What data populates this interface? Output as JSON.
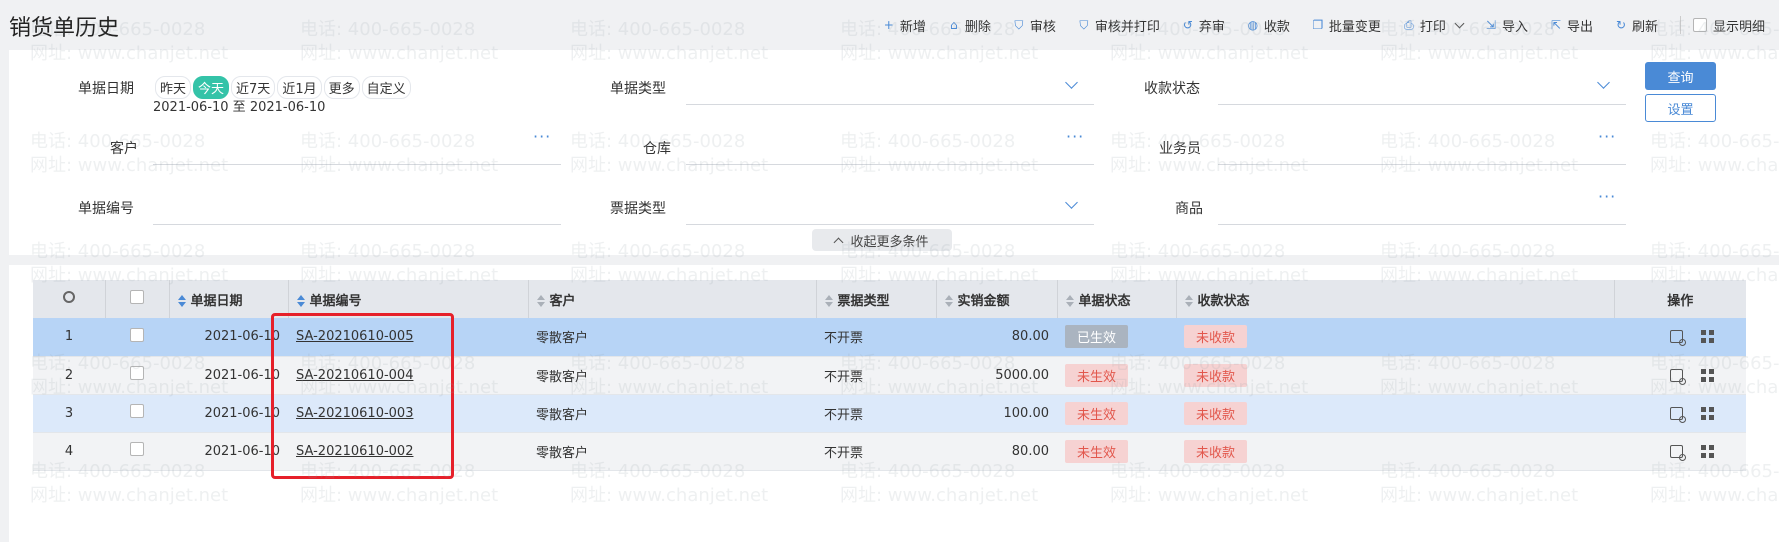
{
  "header": {
    "title": "销货单历史",
    "toolbar": [
      {
        "label": "新增",
        "icon": "plus-icon"
      },
      {
        "label": "删除",
        "icon": "trash-icon"
      },
      {
        "label": "审核",
        "icon": "shield-check-icon"
      },
      {
        "label": "审核并打印",
        "icon": "shield-print-icon"
      },
      {
        "label": "弃审",
        "icon": "undo-icon"
      },
      {
        "label": "收款",
        "icon": "wallet-icon"
      },
      {
        "label": "批量变更",
        "icon": "copy-icon"
      },
      {
        "label": "打印",
        "icon": "printer-icon"
      },
      {
        "label": "导入",
        "icon": "import-icon"
      },
      {
        "label": "导出",
        "icon": "export-icon"
      },
      {
        "label": "刷新",
        "icon": "refresh-icon"
      }
    ],
    "show_detail_label": "显示明细"
  },
  "filters": {
    "date_label": "单据日期",
    "date_options": [
      "昨天",
      "今天",
      "近7天",
      "近1月",
      "更多",
      "自定义"
    ],
    "date_active": "今天",
    "date_range": "2021-06-10 至 2021-06-10",
    "bill_type_label": "单据类型",
    "payment_status_label": "收款状态",
    "customer_label": "客户",
    "warehouse_label": "仓库",
    "salesperson_label": "业务员",
    "bill_no_label": "单据编号",
    "invoice_type_label": "票据类型",
    "product_label": "商品",
    "query_label": "查询",
    "settings_label": "设置",
    "collapse_label": "收起更多条件"
  },
  "table": {
    "columns": {
      "date": "单据日期",
      "bill_no": "单据编号",
      "customer": "客户",
      "invoice_type": "票据类型",
      "amount": "实销金额",
      "bill_status": "单据状态",
      "payment_status": "收款状态",
      "ops": "操作"
    },
    "rows": [
      {
        "idx": "1",
        "date": "2021-06-10",
        "bill_no": "SA-20210610-005",
        "customer": "零散客户",
        "invoice_type": "不开票",
        "amount": "80.00",
        "bill_status": "已生效",
        "payment_status": "未收款"
      },
      {
        "idx": "2",
        "date": "2021-06-10",
        "bill_no": "SA-20210610-004",
        "customer": "零散客户",
        "invoice_type": "不开票",
        "amount": "5000.00",
        "bill_status": "未生效",
        "payment_status": "未收款"
      },
      {
        "idx": "3",
        "date": "2021-06-10",
        "bill_no": "SA-20210610-003",
        "customer": "零散客户",
        "invoice_type": "不开票",
        "amount": "100.00",
        "bill_status": "未生效",
        "payment_status": "未收款"
      },
      {
        "idx": "4",
        "date": "2021-06-10",
        "bill_no": "SA-20210610-002",
        "customer": "零散客户",
        "invoice_type": "不开票",
        "amount": "80.00",
        "bill_status": "未生效",
        "payment_status": "未收款"
      }
    ]
  },
  "watermark": {
    "phone": "电话: 400-665-0028",
    "site": "网址: www.chanjet.net"
  },
  "colors": {
    "accent": "#4a8ad6",
    "active_chip": "#34c3a8",
    "highlight": "#e6202a"
  }
}
